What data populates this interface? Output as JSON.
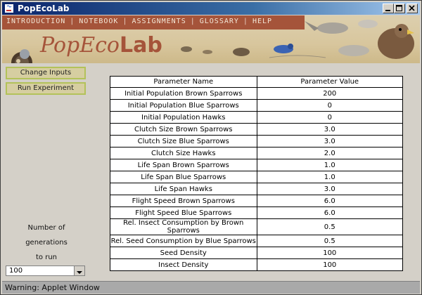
{
  "window": {
    "title": "PopEcoLab"
  },
  "menu": {
    "items": [
      "INTRODUCTION",
      "NOTEBOOK",
      "ASSIGNMENTS",
      "GLOSSARY",
      "HELP"
    ]
  },
  "logo": {
    "text_part1": "PopEco",
    "text_part2": "Lab"
  },
  "buttons": {
    "change_inputs": "Change Inputs",
    "run_experiment": "Run Experiment"
  },
  "generations": {
    "label_line1": "Number of",
    "label_line2": "generations",
    "label_line3": "to run",
    "selected": "100"
  },
  "table": {
    "headers": [
      "Parameter Name",
      "Parameter Value"
    ],
    "rows": [
      [
        "Initial Population Brown Sparrows",
        "200"
      ],
      [
        "Initial Population Blue Sparrows",
        "0"
      ],
      [
        "Initial Population Hawks",
        "0"
      ],
      [
        "Clutch Size Brown Sparrows",
        "3.0"
      ],
      [
        "Clutch Size Blue Sparrows",
        "3.0"
      ],
      [
        "Clutch Size Hawks",
        "2.0"
      ],
      [
        "Life Span Brown Sparrows",
        "1.0"
      ],
      [
        "Life Span Blue Sparrows",
        "1.0"
      ],
      [
        "Life Span Hawks",
        "3.0"
      ],
      [
        "Flight Speed Brown Sparrows",
        "6.0"
      ],
      [
        "Flight Speed Blue Sparrows",
        "6.0"
      ],
      [
        "Rel. Insect Consumption by Brown Sparrows",
        "0.5"
      ],
      [
        "Rel. Seed Consumption by Blue Sparrows",
        "0.5"
      ],
      [
        "Seed Density",
        "100"
      ],
      [
        "Insect Density",
        "100"
      ]
    ]
  },
  "status": {
    "text": "Warning: Applet Window"
  },
  "colors": {
    "menu_bg": "#a5543a",
    "banner_bg": "#d8c69d",
    "button_bg": "#d6cea1",
    "button_border": "#b3c25a"
  }
}
